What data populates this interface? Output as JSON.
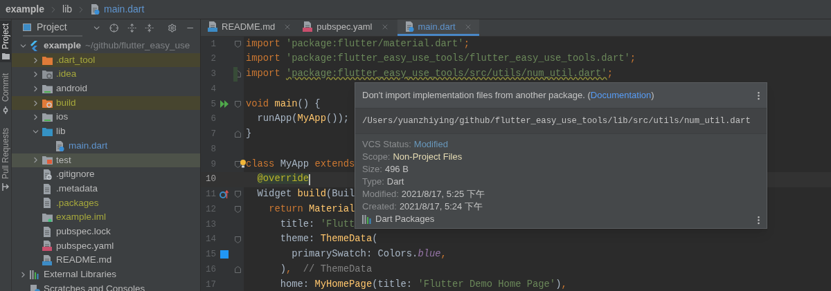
{
  "breadcrumb": [
    {
      "label": "example",
      "kind": "project"
    },
    {
      "label": "lib",
      "kind": "folder"
    },
    {
      "label": "main.dart",
      "kind": "dart"
    }
  ],
  "tool_strip": [
    {
      "label": "Project",
      "kind": "project",
      "selected": true
    },
    {
      "label": "Commit",
      "kind": "commit",
      "selected": false
    },
    {
      "label": "Pull Requests",
      "kind": "pull",
      "selected": false
    }
  ],
  "project_panel": {
    "title": "Project",
    "tree": [
      {
        "label": "example",
        "path": "~/github/flutter_easy_use",
        "kind": "flutter",
        "color": "#bbbbbb",
        "expanded": true,
        "selected": false,
        "excluded": false,
        "children": [
          {
            "label": ".dart_tool",
            "kind": "folder-excluded",
            "color": "#a6a83c",
            "expanded": false,
            "selected": false,
            "excluded": true
          },
          {
            "label": ".idea",
            "kind": "folder-config",
            "color": "#a6a83c",
            "expanded": false,
            "selected": false,
            "excluded": false
          },
          {
            "label": "android",
            "kind": "folder-module",
            "color": "#bbbbbb",
            "expanded": false,
            "selected": false,
            "excluded": false
          },
          {
            "label": "build",
            "kind": "folder-build",
            "color": "#a6a83c",
            "expanded": false,
            "selected": false,
            "excluded": true
          },
          {
            "label": "ios",
            "kind": "folder-module",
            "color": "#bbbbbb",
            "expanded": false,
            "selected": false,
            "excluded": false
          },
          {
            "label": "lib",
            "kind": "folder-source",
            "color": "#bbbbbb",
            "expanded": true,
            "selected": false,
            "excluded": false,
            "children": [
              {
                "label": "main.dart",
                "kind": "dart",
                "color": "#5f94cd",
                "selected": false,
                "excluded": false
              }
            ]
          },
          {
            "label": "test",
            "kind": "folder-test",
            "color": "#bbbbbb",
            "expanded": false,
            "selected": true,
            "excluded": false
          },
          {
            "label": ".gitignore",
            "kind": "file-ignore",
            "color": "#bbbbbb",
            "selected": false,
            "excluded": false
          },
          {
            "label": ".metadata",
            "kind": "file-text",
            "color": "#bbbbbb",
            "selected": false,
            "excluded": false
          },
          {
            "label": ".packages",
            "kind": "file-text",
            "color": "#a6a83c",
            "selected": false,
            "excluded": false
          },
          {
            "label": "example.iml",
            "kind": "file-module",
            "color": "#a6a83c",
            "selected": false,
            "excluded": false
          },
          {
            "label": "pubspec.lock",
            "kind": "file-text",
            "color": "#bbbbbb",
            "selected": false,
            "excluded": false
          },
          {
            "label": "pubspec.yaml",
            "kind": "yaml",
            "color": "#bbbbbb",
            "selected": false,
            "excluded": false
          },
          {
            "label": "README.md",
            "kind": "markdown",
            "color": "#bbbbbb",
            "selected": false,
            "excluded": false
          }
        ]
      },
      {
        "label": "External Libraries",
        "kind": "libraries",
        "color": "#bbbbbb",
        "expanded": false,
        "selected": false,
        "excluded": false
      },
      {
        "label": "Scratches and Consoles",
        "kind": "scratches",
        "color": "#bbbbbb",
        "selected": false,
        "excluded": false
      }
    ]
  },
  "tabs": [
    {
      "label": "README.md",
      "kind": "markdown",
      "selected": false
    },
    {
      "label": "pubspec.yaml",
      "kind": "yaml",
      "selected": false
    },
    {
      "label": "main.dart",
      "kind": "dart",
      "selected": true
    }
  ],
  "code_lines": [
    {
      "number": "1",
      "fold_start": true,
      "tokens": [
        {
          "text": "import",
          "kind": "keyword"
        },
        {
          "text": " 'package:flutter/material.dart'",
          "kind": "string"
        },
        {
          "text": ";",
          "kind": "keyword"
        }
      ]
    },
    {
      "number": "2",
      "tokens": [
        {
          "text": "import",
          "kind": "keyword"
        },
        {
          "text": " 'package:flutter_easy_use_tools/flutter_easy_use_tools.dart'",
          "kind": "string"
        },
        {
          "text": ";",
          "kind": "keyword"
        }
      ]
    },
    {
      "number": "3",
      "fold_end": true,
      "changed": true,
      "tokens": [
        {
          "text": "import",
          "kind": "keyword"
        },
        {
          "text": " 'package:flutter_easy_use_tools/src/utils/num_util.dart'",
          "kind": "warning"
        },
        {
          "text": ";",
          "kind": "keyword"
        }
      ]
    },
    {
      "number": "4"
    },
    {
      "number": "5",
      "fold_start": true,
      "run": true,
      "tokens": [
        {
          "text": "void",
          "kind": "keyword"
        },
        {
          "text": " main",
          "kind": "function"
        },
        {
          "text": "() {",
          "kind": "plain"
        }
      ]
    },
    {
      "number": "6",
      "tokens": [
        {
          "text": "  runApp(",
          "kind": "plain"
        },
        {
          "text": "MyApp",
          "kind": "function"
        },
        {
          "text": "());",
          "kind": "plain"
        }
      ]
    },
    {
      "number": "7",
      "fold_end": true,
      "tokens": [
        {
          "text": "}",
          "kind": "plain"
        }
      ]
    },
    {
      "number": "8"
    },
    {
      "number": "9",
      "fold_start": true,
      "bulb": true,
      "tokens": [
        {
          "text": "class",
          "kind": "keyword"
        },
        {
          "text": " MyApp ",
          "kind": "plain"
        },
        {
          "text": "extends",
          "kind": "keyword"
        }
      ]
    },
    {
      "number": "10",
      "current": true,
      "tokens": [
        {
          "text": "  @override",
          "kind": "annotation"
        }
      ]
    },
    {
      "number": "11",
      "fold_start": true,
      "override": true,
      "tokens": [
        {
          "text": "  Widget ",
          "kind": "plain"
        },
        {
          "text": "build",
          "kind": "function"
        },
        {
          "text": "(Buil",
          "kind": "plain"
        }
      ]
    },
    {
      "number": "12",
      "fold_start": true,
      "tokens": [
        {
          "text": "    return",
          "kind": "keyword"
        },
        {
          "text": " Material",
          "kind": "function"
        }
      ]
    },
    {
      "number": "13",
      "tokens": [
        {
          "text": "      title: ",
          "kind": "plain"
        },
        {
          "text": "'Flutt",
          "kind": "string"
        }
      ]
    },
    {
      "number": "14",
      "fold_start": true,
      "tokens": [
        {
          "text": "      theme: ",
          "kind": "plain"
        },
        {
          "text": "ThemeData",
          "kind": "function"
        },
        {
          "text": "(",
          "kind": "plain"
        }
      ]
    },
    {
      "number": "15",
      "color": "#2196f3",
      "tokens": [
        {
          "text": "        primarySwatch: Colors.",
          "kind": "plain"
        },
        {
          "text": "blue",
          "kind": "constant"
        },
        {
          "text": ",",
          "kind": "keyword"
        }
      ]
    },
    {
      "number": "16",
      "fold_end": true,
      "tokens": [
        {
          "text": "      )",
          "kind": "plain"
        },
        {
          "text": ",",
          "kind": "keyword"
        },
        {
          "text": "  // ThemeData",
          "kind": "comment"
        }
      ]
    },
    {
      "number": "17",
      "tokens": [
        {
          "text": "      home: ",
          "kind": "plain"
        },
        {
          "text": "MyHomePage",
          "kind": "function"
        },
        {
          "text": "(title: ",
          "kind": "plain"
        },
        {
          "text": "'Flutter Demo Home Page'",
          "kind": "string"
        },
        {
          "text": ")",
          "kind": "plain"
        },
        {
          "text": ",",
          "kind": "keyword"
        }
      ]
    }
  ],
  "popup": {
    "message": "Don't import implementation files from another package. (",
    "link": "Documentation",
    "message_end": ")",
    "path": "/Users/yuanzhiying/github/flutter_easy_use_tools/lib/src/utils/num_util.dart",
    "details": [
      {
        "label": "VCS Status:",
        "value": "Modified",
        "kind": "vcs"
      },
      {
        "label": "Scope:",
        "value": "Non-Project Files",
        "kind": "scope"
      },
      {
        "label": "Size:",
        "value": "496 B",
        "kind": "plain"
      },
      {
        "label": "Type:",
        "value": "Dart",
        "kind": "plain"
      },
      {
        "label": "Modified:",
        "value": "2021/8/17, 5:25 下午",
        "kind": "plain"
      },
      {
        "label": "Created:",
        "value": "2021/8/17, 5:24 下午",
        "kind": "plain"
      }
    ],
    "library": "Dart Packages"
  }
}
